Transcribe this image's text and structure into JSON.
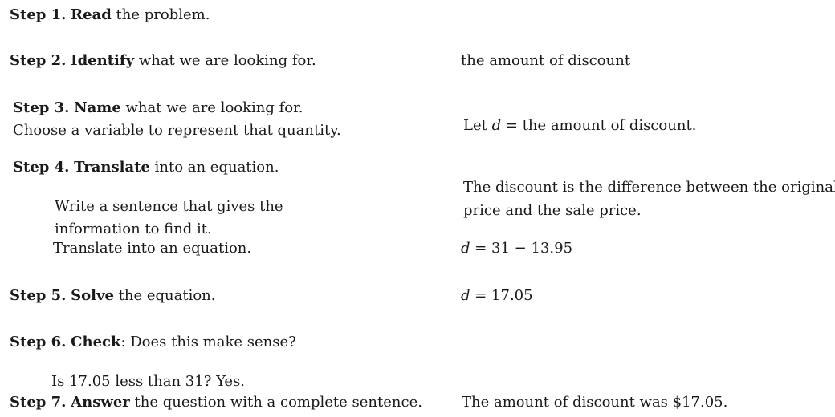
{
  "steps": {
    "s1": {
      "label": "Step 1.",
      "keyword": "Read",
      "text": " the problem."
    },
    "s2": {
      "label": "Step 2.",
      "keyword": "Identify",
      "text": " what we are looking for."
    },
    "s3": {
      "label": "Step 3.",
      "keyword": "Name",
      "text": " what we are looking for.",
      "line2": "Choose a variable to represent that quantity."
    },
    "s4": {
      "label": "Step 4.",
      "keyword": "Translate",
      "text": " into an equation.",
      "sub1a": "Write a sentence that gives the",
      "sub1b": "information to find it.",
      "sub2": "Translate into an equation."
    },
    "s5": {
      "label": "Step 5.",
      "keyword": "Solve",
      "text": " the equation."
    },
    "s6": {
      "label": "Step 6.",
      "keyword": "Check",
      "text": ": Does this make sense?",
      "sub": "Is 17.05 less than 31? Yes."
    },
    "s7": {
      "label": "Step 7.",
      "keyword": "Answer",
      "text": " the question with a complete sentence."
    }
  },
  "right": {
    "s2": "the amount of discount",
    "s3_prefix": "Let ",
    "s3_var": "d",
    "s3_suffix": " = the amount of discount.",
    "s4_line1": "The discount is the difference between the original",
    "s4_line2": "price and the sale price.",
    "s4_eq_var": "d",
    "s4_eq_rest": " = 31 − 13.95",
    "s5_var": "d",
    "s5_rest": " = 17.05",
    "s7": "The amount of discount was $17.05."
  }
}
